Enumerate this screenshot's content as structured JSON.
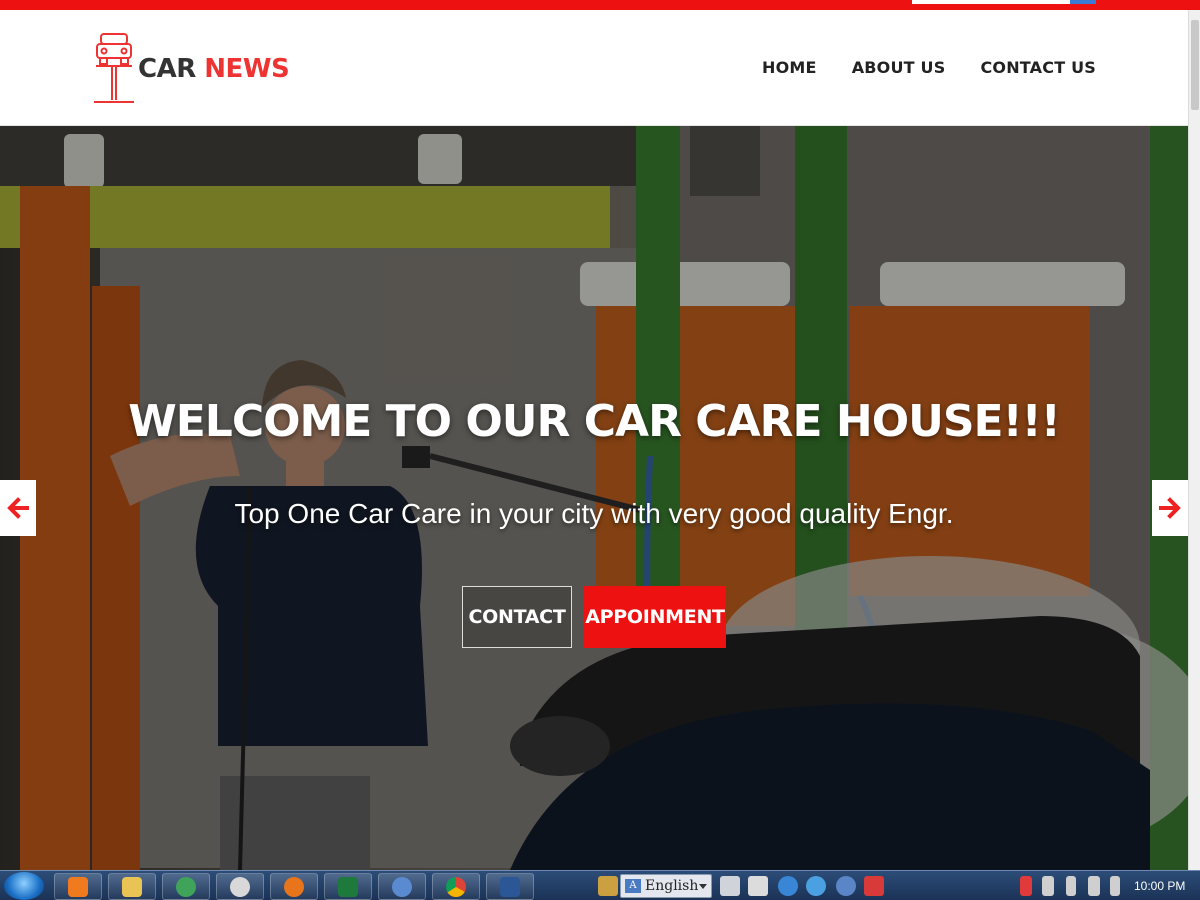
{
  "brand": {
    "word1": "CAR",
    "word2": "NEWS",
    "accent": "#ee3333"
  },
  "nav": [
    {
      "label": "HOME"
    },
    {
      "label": "ABOUT US"
    },
    {
      "label": "CONTACT US"
    }
  ],
  "hero": {
    "title": "WELCOME TO OUR CAR CARE HOUSE!!!",
    "subtitle": "Top One Car Care in your city with very good quality Engr.",
    "contact_label": "CONTACT",
    "appointment_label": "APPOINMENT",
    "prev_icon": "arrow-left-icon",
    "next_icon": "arrow-right-icon"
  },
  "taskbar": {
    "language": "English",
    "clock": "10:00 PM"
  },
  "colors": {
    "topbar": "#ee1111",
    "button_red": "#ee1111",
    "taskbar": "#1b3256"
  }
}
